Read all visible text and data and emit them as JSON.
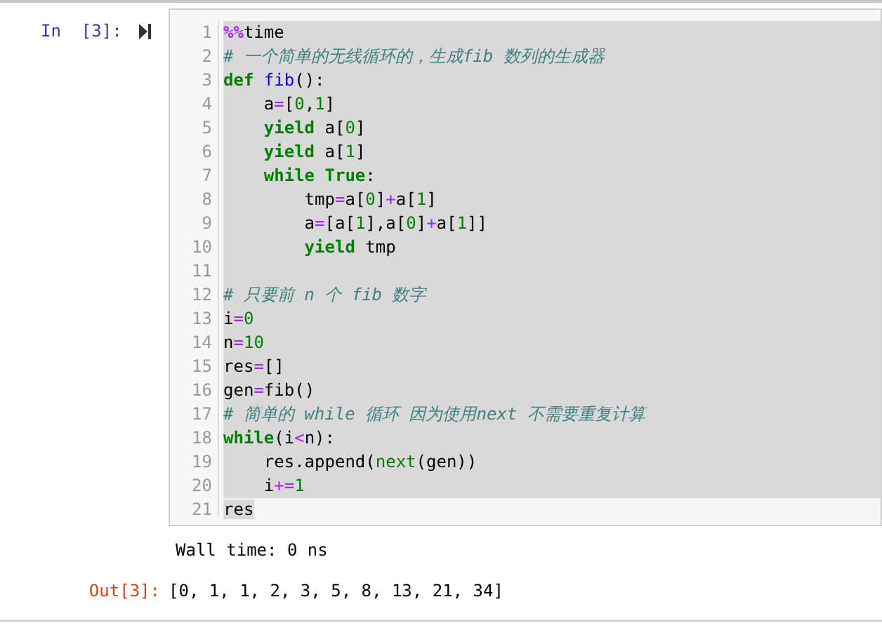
{
  "input_prompt": "In  [3]:",
  "code_lines": [
    {
      "number": "1",
      "selected": true,
      "tokens": [
        {
          "kind": "magic",
          "text": "%%"
        },
        {
          "kind": "name",
          "text": "time"
        }
      ]
    },
    {
      "number": "2",
      "selected": true,
      "tokens": [
        {
          "kind": "comment",
          "text": "# 一个简单的无线循环的，生成fib 数列的生成器"
        }
      ]
    },
    {
      "number": "3",
      "selected": true,
      "tokens": [
        {
          "kind": "keyword",
          "text": "def"
        },
        {
          "kind": "defname",
          "text": " fib"
        },
        {
          "kind": "name",
          "text": "():"
        }
      ]
    },
    {
      "number": "4",
      "selected": true,
      "tokens": [
        {
          "kind": "name",
          "text": "    a"
        },
        {
          "kind": "op",
          "text": "="
        },
        {
          "kind": "name",
          "text": "["
        },
        {
          "kind": "number",
          "text": "0"
        },
        {
          "kind": "name",
          "text": ","
        },
        {
          "kind": "number",
          "text": "1"
        },
        {
          "kind": "name",
          "text": "]"
        }
      ]
    },
    {
      "number": "5",
      "selected": true,
      "tokens": [
        {
          "kind": "keyword",
          "text": "    yield"
        },
        {
          "kind": "name",
          "text": " a["
        },
        {
          "kind": "number",
          "text": "0"
        },
        {
          "kind": "name",
          "text": "]"
        }
      ]
    },
    {
      "number": "6",
      "selected": true,
      "tokens": [
        {
          "kind": "keyword",
          "text": "    yield"
        },
        {
          "kind": "name",
          "text": " a["
        },
        {
          "kind": "number",
          "text": "1"
        },
        {
          "kind": "name",
          "text": "]"
        }
      ]
    },
    {
      "number": "7",
      "selected": true,
      "tokens": [
        {
          "kind": "keyword",
          "text": "    while"
        },
        {
          "kind": "keyword",
          "text": " True"
        },
        {
          "kind": "name",
          "text": ":"
        }
      ]
    },
    {
      "number": "8",
      "selected": true,
      "tokens": [
        {
          "kind": "name",
          "text": "        tmp"
        },
        {
          "kind": "op",
          "text": "="
        },
        {
          "kind": "name",
          "text": "a["
        },
        {
          "kind": "number",
          "text": "0"
        },
        {
          "kind": "name",
          "text": "]"
        },
        {
          "kind": "op",
          "text": "+"
        },
        {
          "kind": "name",
          "text": "a["
        },
        {
          "kind": "number",
          "text": "1"
        },
        {
          "kind": "name",
          "text": "]"
        }
      ]
    },
    {
      "number": "9",
      "selected": true,
      "tokens": [
        {
          "kind": "name",
          "text": "        a"
        },
        {
          "kind": "op",
          "text": "="
        },
        {
          "kind": "name",
          "text": "[a["
        },
        {
          "kind": "number",
          "text": "1"
        },
        {
          "kind": "name",
          "text": "],a["
        },
        {
          "kind": "number",
          "text": "0"
        },
        {
          "kind": "name",
          "text": "]"
        },
        {
          "kind": "op",
          "text": "+"
        },
        {
          "kind": "name",
          "text": "a["
        },
        {
          "kind": "number",
          "text": "1"
        },
        {
          "kind": "name",
          "text": "]]"
        }
      ]
    },
    {
      "number": "10",
      "selected": true,
      "tokens": [
        {
          "kind": "keyword",
          "text": "        yield"
        },
        {
          "kind": "name",
          "text": " tmp"
        }
      ]
    },
    {
      "number": "11",
      "selected": true
    },
    {
      "number": "12",
      "selected": true,
      "tokens": [
        {
          "kind": "comment",
          "text": "# 只要前 n 个 fib 数字"
        }
      ]
    },
    {
      "number": "13",
      "selected": true,
      "tokens": [
        {
          "kind": "name",
          "text": "i"
        },
        {
          "kind": "op",
          "text": "="
        },
        {
          "kind": "number",
          "text": "0"
        }
      ]
    },
    {
      "number": "14",
      "selected": true,
      "tokens": [
        {
          "kind": "name",
          "text": "n"
        },
        {
          "kind": "op",
          "text": "="
        },
        {
          "kind": "number",
          "text": "10"
        }
      ]
    },
    {
      "number": "15",
      "selected": true,
      "tokens": [
        {
          "kind": "name",
          "text": "res"
        },
        {
          "kind": "op",
          "text": "="
        },
        {
          "kind": "name",
          "text": "[]"
        }
      ]
    },
    {
      "number": "16",
      "selected": true,
      "tokens": [
        {
          "kind": "name",
          "text": "gen"
        },
        {
          "kind": "op",
          "text": "="
        },
        {
          "kind": "name",
          "text": "fib()"
        }
      ]
    },
    {
      "number": "17",
      "selected": true,
      "tokens": [
        {
          "kind": "comment",
          "text": "# 简单的 while 循环 因为使用next 不需要重复计算"
        }
      ]
    },
    {
      "number": "18",
      "selected": true,
      "tokens": [
        {
          "kind": "keyword",
          "text": "while"
        },
        {
          "kind": "name",
          "text": "(i"
        },
        {
          "kind": "op",
          "text": "<"
        },
        {
          "kind": "name",
          "text": "n):"
        }
      ]
    },
    {
      "number": "19",
      "selected": true,
      "tokens": [
        {
          "kind": "name",
          "text": "    res.append("
        },
        {
          "kind": "builtin",
          "text": "next"
        },
        {
          "kind": "name",
          "text": "(gen))"
        }
      ]
    },
    {
      "number": "20",
      "selected": true,
      "tokens": [
        {
          "kind": "name",
          "text": "    i"
        },
        {
          "kind": "op",
          "text": "+="
        },
        {
          "kind": "number",
          "text": "1"
        }
      ]
    },
    {
      "number": "21",
      "selected": false,
      "tokens": [
        {
          "kind": "name",
          "text": "res",
          "selected": true
        }
      ]
    }
  ],
  "stdout": "Wall time: 0 ns",
  "output_prompt": "Out[3]:",
  "output_value": "[0, 1, 1, 2, 3, 5, 8, 13, 21, 34]"
}
